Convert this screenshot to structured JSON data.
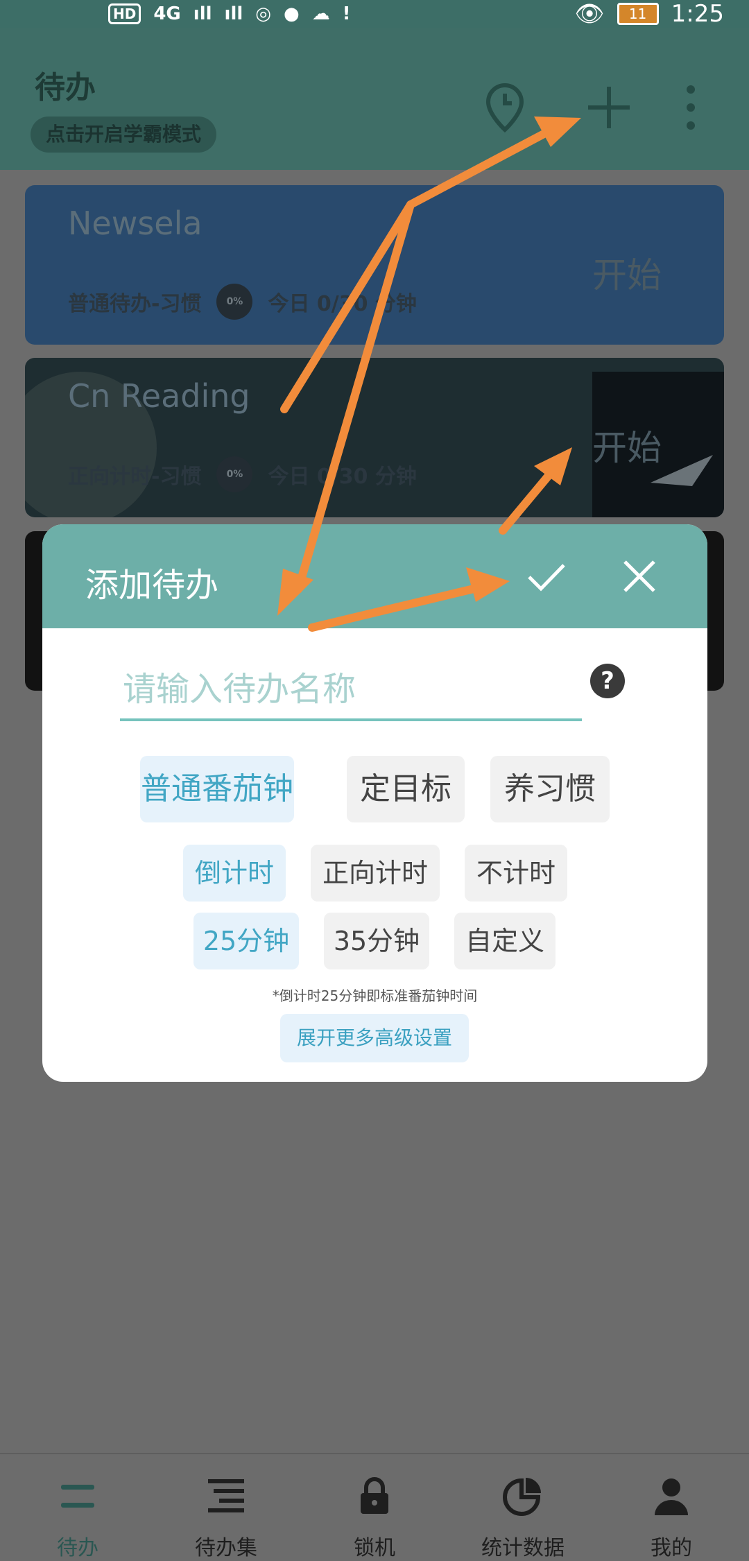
{
  "status_bar": {
    "left": [
      "HD",
      "4G",
      "ıll",
      "ıll"
    ],
    "time": "1:25",
    "battery": "11"
  },
  "app_bar": {
    "title": "待办",
    "mode_chip": "点击开启学霸模式"
  },
  "cards": [
    {
      "title": "Newsela",
      "type_label": "普通待办-习惯",
      "percent": "0%",
      "today": "今日 0/30 分钟",
      "start_label": "开始",
      "bg": "#294a6d"
    },
    {
      "title": "Cn Reading",
      "type_label": "正向计时-习惯",
      "percent": "0%",
      "today": "今日 0/30 分钟",
      "start_label": "开始",
      "bg": "#1e2d31"
    },
    {
      "title": "",
      "type_label": "",
      "percent": "",
      "today": "",
      "start_label": "",
      "bg": "#121212"
    }
  ],
  "dialog": {
    "title": "添加待办",
    "confirm_icon": "check-icon",
    "close_icon": "close-icon",
    "name_placeholder": "请输入待办名称",
    "help": "?",
    "type_options": [
      "普通番茄钟",
      "定目标",
      "养习惯"
    ],
    "timing_options": [
      "倒计时",
      "正向计时",
      "不计时"
    ],
    "duration_options": [
      "25分钟",
      "35分钟",
      "自定义"
    ],
    "hint": "*倒计时25分钟即标准番茄钟时间",
    "advanced_button": "展开更多高级设置"
  },
  "bottom_nav": [
    {
      "label": "待办",
      "icon": "list-icon",
      "active": true
    },
    {
      "label": "待办集",
      "icon": "collection-icon",
      "active": false
    },
    {
      "label": "锁机",
      "icon": "lock-icon",
      "active": false
    },
    {
      "label": "统计数据",
      "icon": "pie-chart-icon",
      "active": false
    },
    {
      "label": "我的",
      "icon": "person-icon",
      "active": false
    }
  ],
  "colors": {
    "accent": "#6dafa8",
    "selected_text": "#41a6c4",
    "annotation": "#f28c3b"
  }
}
